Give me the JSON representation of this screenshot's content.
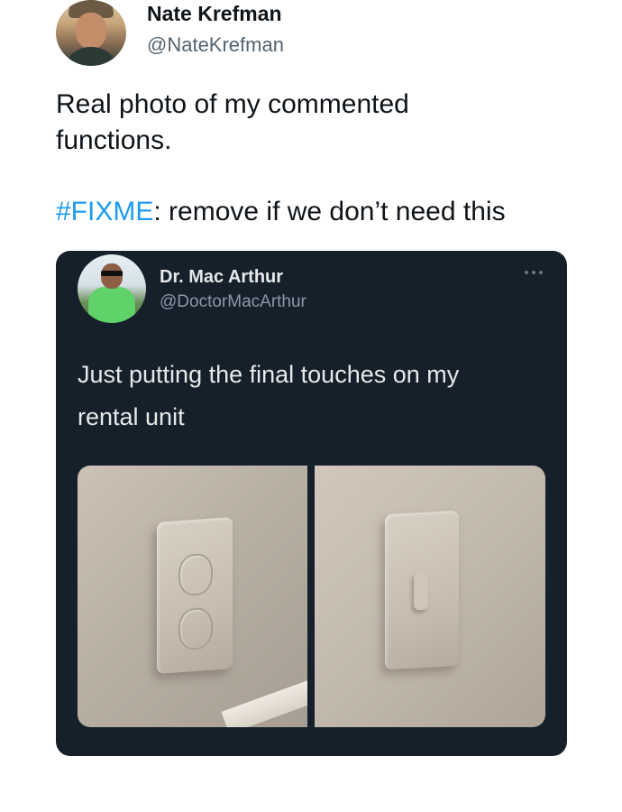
{
  "tweet": {
    "author_name": "Nate Krefman",
    "author_handle": "@NateKrefman",
    "text_line1": "Real photo of my commented",
    "text_line2": "functions.",
    "hashtag": "#FIXME",
    "text_line3_rest": ": remove if we don’t need this"
  },
  "quoted_tweet": {
    "author_name": "Dr. Mac Arthur",
    "author_handle": "@DoctorMacArthur",
    "text_line1": "Just putting the final touches on my",
    "text_line2": "rental unit",
    "more_icon": "more-horizontal-icon"
  },
  "colors": {
    "hashtag": "#1d9bf0",
    "card_background": "#15202b",
    "page_background": "#ffffff"
  }
}
